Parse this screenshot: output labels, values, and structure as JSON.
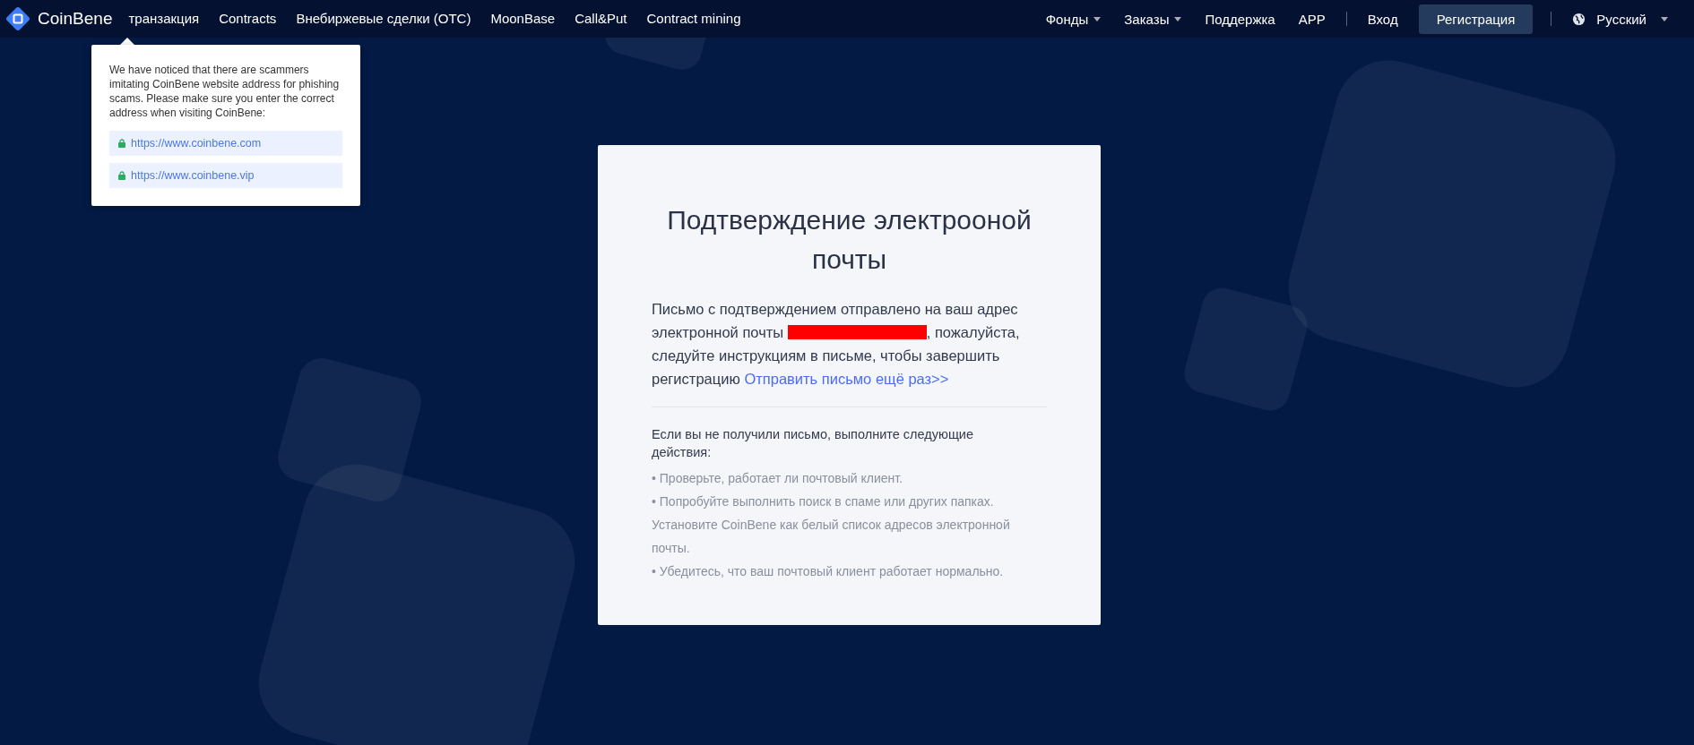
{
  "nav": {
    "brand": "CoinBene",
    "menu": [
      "транзакция",
      "Contracts",
      "Внебиржевые сделки (OTC)",
      "MoonBase",
      "Call&Put",
      "Contract mining"
    ],
    "right": [
      {
        "kind": "dropdown",
        "label": "Фонды"
      },
      {
        "kind": "dropdown",
        "label": "Заказы"
      },
      {
        "kind": "link",
        "label": "Поддержка"
      },
      {
        "kind": "link",
        "label": "APP"
      },
      {
        "kind": "divider"
      },
      {
        "kind": "link",
        "label": "Вход"
      },
      {
        "kind": "button",
        "label": "Регистрация"
      },
      {
        "kind": "divider"
      },
      {
        "kind": "language",
        "label": "Русский"
      }
    ]
  },
  "notice": {
    "text": "We have noticed that there are scammers imitating CoinBene website address for phishing scams. Please make sure you enter the correct address when visiting CoinBene:",
    "links": [
      "https://www.coinbene.com",
      "https://www.coinbene.vip"
    ]
  },
  "card": {
    "title": "Подтверждение электрооной почты",
    "message": {
      "before": "Письмо с подтверждением отправлено на ваш адрес электронной почты ",
      "redacted": true,
      "after": ", пожалуйста, следуйте инструкциям в письме, чтобы завершить регистрацию ",
      "link": "Отправить письмо ещё раз>>"
    },
    "help_title": "Если вы не получили письмо, выполните следующие действия:",
    "help_lines": [
      "• Проверьте, работает ли почтовый клиент.",
      "• Попробуйте выполнить поиск в спаме или других папках.",
      "Установите CoinBene как белый список адресов электронной почты.",
      "• Убедитесь, что ваш почтовый клиент работает нормально."
    ]
  }
}
